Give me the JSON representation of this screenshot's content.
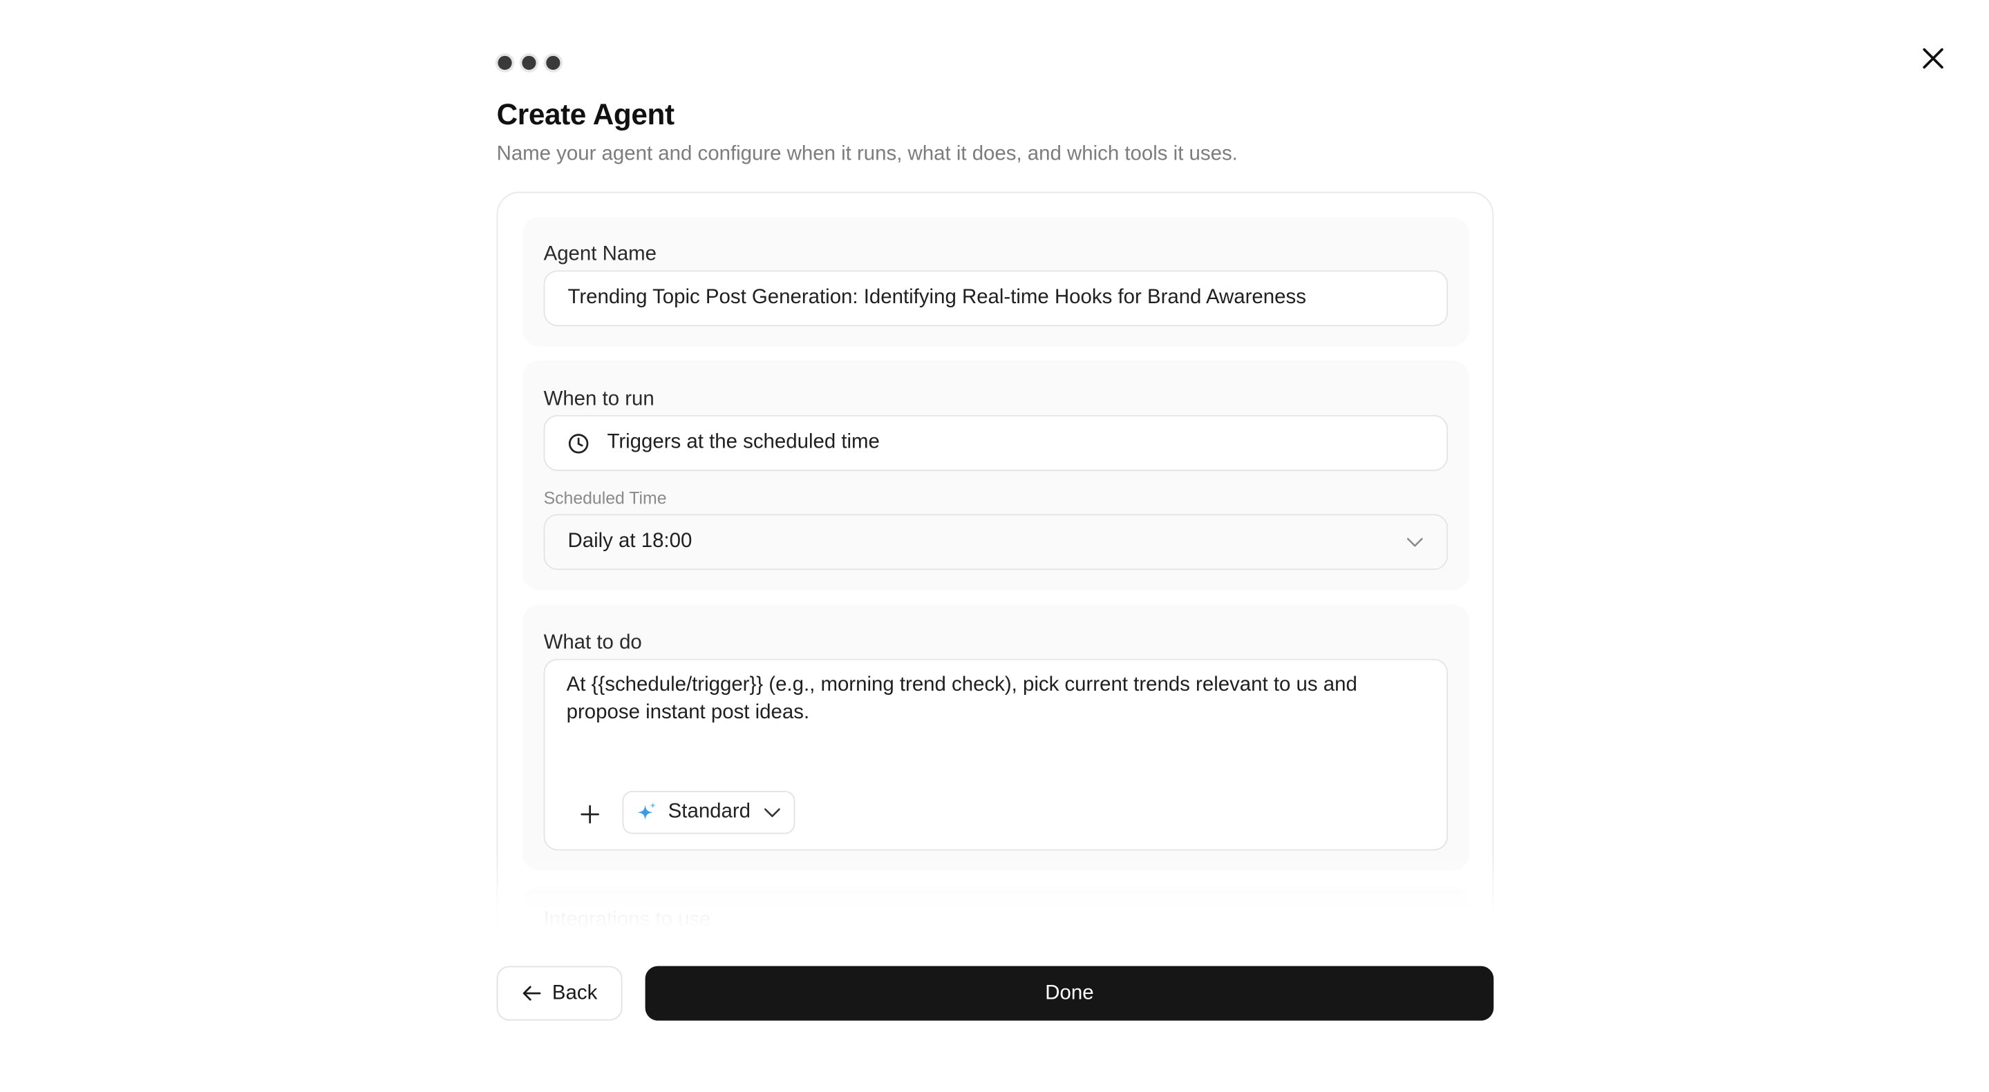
{
  "header": {
    "title": "Create Agent",
    "subtitle": "Name your agent and configure when it runs, what it does, and which tools it uses.",
    "step_count": 3
  },
  "agent_name": {
    "label": "Agent Name",
    "value": "Trending Topic Post Generation: Identifying Real-time Hooks for Brand Awareness"
  },
  "when_to_run": {
    "label": "When to run",
    "trigger_value": "Triggers at the scheduled time",
    "trigger_icon": "clock-icon",
    "scheduled_time_label": "Scheduled Time",
    "scheduled_time_value": "Daily at 18:00"
  },
  "what_to_do": {
    "label": "What to do",
    "value": "At {{schedule/trigger}} (e.g., morning trend check), pick current trends relevant to us and propose instant post ideas.",
    "mode_label": "Standard",
    "mode_icon": "sparkle-icon"
  },
  "integrations": {
    "label": "Integrations to use"
  },
  "footer": {
    "back_label": "Back",
    "done_label": "Done"
  },
  "colors": {
    "primary_button": "#161616",
    "sparkle_accent": "#3b9be8",
    "muted_text": "#7c7c7c"
  }
}
